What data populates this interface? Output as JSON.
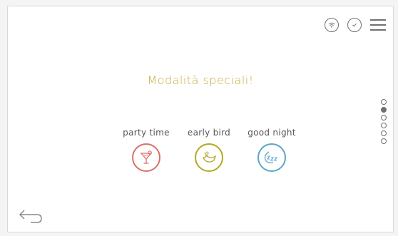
{
  "colors": {
    "title": "#c4a93a",
    "party_time": "#d9706a",
    "early_bird": "#b5a722",
    "good_night": "#5aa6c8",
    "icon_gray": "#707070"
  },
  "header": {
    "icons": [
      "wifi-icon",
      "chat-check-icon",
      "menu-icon"
    ]
  },
  "title": "Modalità speciali!",
  "modes": [
    {
      "label": "party time",
      "icon": "cocktail-icon"
    },
    {
      "label": "early bird",
      "icon": "bird-icon"
    },
    {
      "label": "good night",
      "icon": "sleep-icon"
    }
  ],
  "pager": {
    "total": 6,
    "active_index": 1
  },
  "footer": {
    "icon": "back-arrow-icon"
  }
}
